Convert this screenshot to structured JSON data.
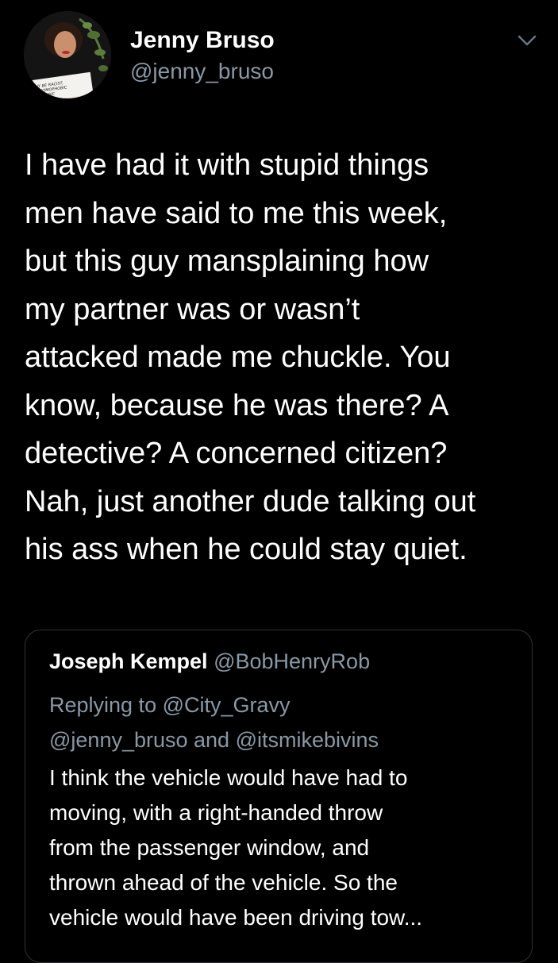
{
  "tweet": {
    "author_name": "Jenny Bruso",
    "author_handle": "@jenny_bruso",
    "avatar_sign_text": [
      "WHY BE RACIST,",
      "...T HOMOPHOBIC",
      "...ORHOBIC"
    ],
    "text_lines": [
      "I have had it with stupid things",
      "men have said to me this week,",
      "but this guy mansplaining how",
      "my partner was or wasn’t",
      "attacked made me chuckle. You",
      "know, because he was there? A",
      "detective? A concerned citizen?",
      "Nah, just another dude talking out",
      "his ass when he could stay quiet."
    ],
    "menu_icon": "chevron-down-icon"
  },
  "quoted_tweet": {
    "author_name": "Joseph Kempel",
    "author_handle": "@BobHenryRob",
    "replying_to_line1": "Replying to @City_Gravy",
    "replying_to_line2": "@jenny_bruso and @itsmikebivins",
    "body_lines": [
      "I think the vehicle would have had to",
      "moving, with a right-handed throw",
      "from the passenger window, and",
      "thrown ahead of the vehicle.  So the",
      "vehicle would have been driving tow..."
    ]
  },
  "colors": {
    "background": "#000000",
    "primary_text": "#ffffff",
    "secondary_text": "#8899a6",
    "card_border": "#2f3336"
  }
}
